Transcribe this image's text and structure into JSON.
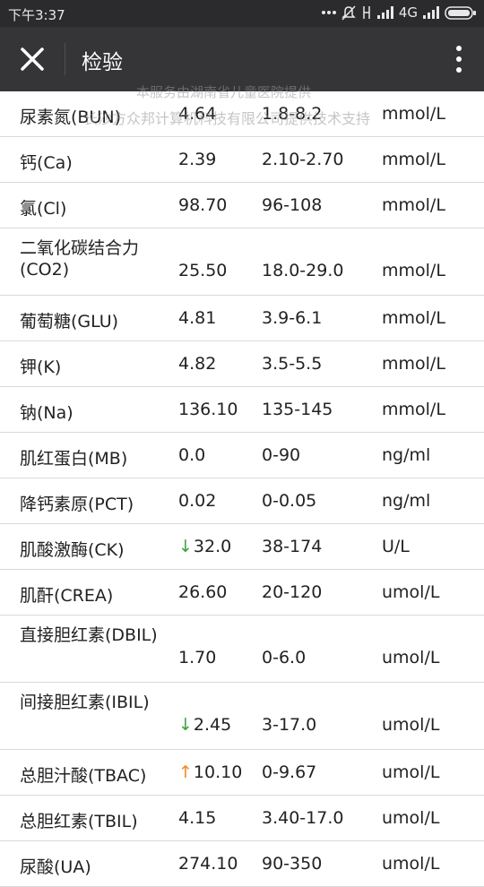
{
  "status_bar": {
    "time": "下午3:37",
    "network": "4G",
    "icons": [
      "more-dots-icon",
      "mute-icon",
      "sim-icon",
      "signal-icon",
      "signal-icon-2",
      "battery-icon"
    ]
  },
  "nav": {
    "title": "检验",
    "close_icon": "close-icon",
    "more_icon": "more-vertical-icon"
  },
  "watermark": {
    "line1": "本服务由湖南省儿童医院提供",
    "line2": "长沙方众邦计算机科技有限公司提供技术支持"
  },
  "results": [
    {
      "name": "尿素氮(BUN)",
      "value": "4.64",
      "flag": "",
      "ref": "1.8-8.2",
      "unit": "mmol/L"
    },
    {
      "name": "钙(Ca)",
      "value": "2.39",
      "flag": "",
      "ref": "2.10-2.70",
      "unit": "mmol/L"
    },
    {
      "name": "氯(Cl)",
      "value": "98.70",
      "flag": "",
      "ref": "96-108",
      "unit": "mmol/L"
    },
    {
      "name": "二氧化碳结合力(CO2)",
      "value": "25.50",
      "flag": "",
      "ref": "18.0-29.0",
      "unit": "mmol/L"
    },
    {
      "name": "葡萄糖(GLU)",
      "value": "4.81",
      "flag": "",
      "ref": "3.9-6.1",
      "unit": "mmol/L"
    },
    {
      "name": "钾(K)",
      "value": "4.82",
      "flag": "",
      "ref": "3.5-5.5",
      "unit": "mmol/L"
    },
    {
      "name": "钠(Na)",
      "value": "136.10",
      "flag": "",
      "ref": "135-145",
      "unit": "mmol/L"
    },
    {
      "name": "肌红蛋白(MB)",
      "value": "0.0",
      "flag": "",
      "ref": "0-90",
      "unit": "ng/ml"
    },
    {
      "name": "降钙素原(PCT)",
      "value": "0.02",
      "flag": "",
      "ref": "0-0.05",
      "unit": "ng/ml"
    },
    {
      "name": "肌酸激酶(CK)",
      "value": "32.0",
      "flag": "↓",
      "ref": "38-174",
      "unit": "U/L"
    },
    {
      "name": "肌酐(CREA)",
      "value": "26.60",
      "flag": "",
      "ref": "20-120",
      "unit": "umol/L"
    },
    {
      "name": "直接胆红素(DBIL)",
      "value": "1.70",
      "flag": "",
      "ref": "0-6.0",
      "unit": "umol/L"
    },
    {
      "name": "间接胆红素(IBIL)",
      "value": "2.45",
      "flag": "↓",
      "ref": "3-17.0",
      "unit": "umol/L"
    },
    {
      "name": "总胆汁酸(TBAC)",
      "value": "10.10",
      "flag": "↑",
      "ref": "0-9.67",
      "unit": "umol/L"
    },
    {
      "name": "总胆红素(TBIL)",
      "value": "4.15",
      "flag": "",
      "ref": "3.40-17.0",
      "unit": "umol/L"
    },
    {
      "name": "尿酸(UA)",
      "value": "274.10",
      "flag": "",
      "ref": "90-350",
      "unit": "umol/L"
    }
  ],
  "colors": {
    "flag_down": "#3da23d",
    "flag_up": "#f08a1a",
    "nav_bg": "#353538",
    "status_bg": "#2b2b2d"
  }
}
